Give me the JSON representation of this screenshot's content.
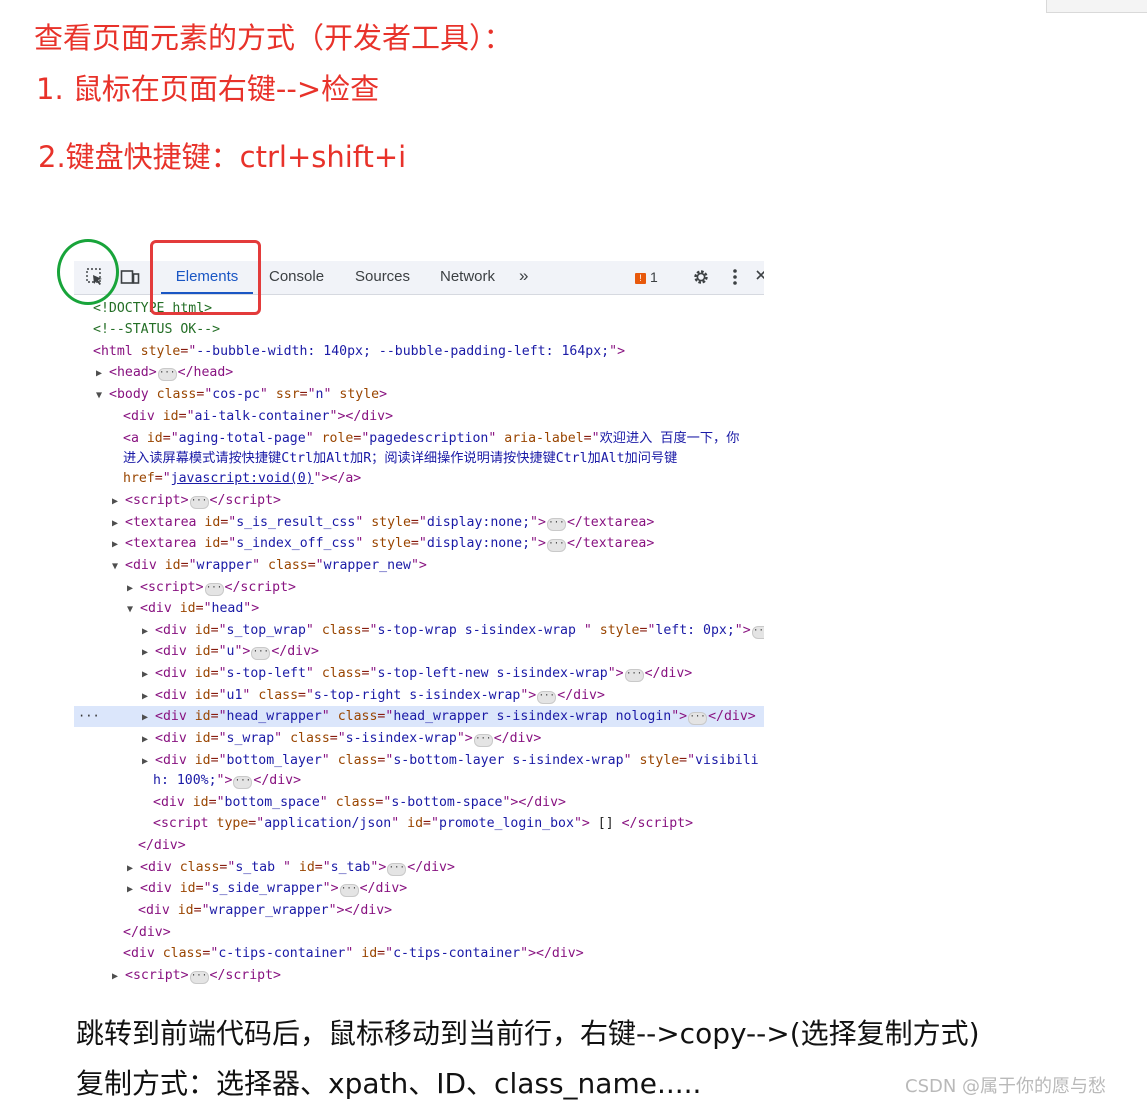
{
  "notes": {
    "line1": "查看页面元素的方式（开发者工具）：",
    "line2": "1. 鼠标在页面右键-->检查",
    "line3": "2.键盘快捷键：ctrl+shift+i",
    "line4": "跳转到前端代码后，鼠标移动到当前行，右键-->copy-->(选择复制方式)",
    "line5": "复制方式：选择器、xpath、ID、class_name....."
  },
  "devtools": {
    "tabs": [
      "Elements",
      "Console",
      "Sources",
      "Network"
    ],
    "more_tabs": "»",
    "issues_count": "1",
    "issue_badge": "!",
    "active_tab": "Elements"
  },
  "dom": {
    "doctype": "<!DOCTYPE html>",
    "comment": "<!--STATUS OK-->",
    "html_style": "--bubble-width: 140px; --bubble-padding-left: 164px;",
    "body_class": "cos-pc",
    "body_ssr": "n",
    "ai_talk_id": "ai-talk-container",
    "a_id": "aging-total-page",
    "a_role": "pagedescription",
    "a_aria_label": "欢迎进入 百度一下，你",
    "a_aria_label_cont": "进入读屏幕模式请按快捷键Ctrl加Alt加R；阅读详细操作说明请按快捷键Ctrl加Alt加问号键",
    "a_href": "javascript:void(0)",
    "ta1_id": "s_is_result_css",
    "ta2_id": "s_index_off_css",
    "ta_style": "display:none;",
    "wrapper_id": "wrapper",
    "wrapper_class": "wrapper_new",
    "head_id": "head",
    "top_wrap_id": "s_top_wrap",
    "top_wrap_class": "s-top-wrap s-isindex-wrap ",
    "top_wrap_style": "left: 0px;",
    "u_id": "u",
    "top_left_id": "s-top-left",
    "top_left_class": "s-top-left-new s-isindex-wrap",
    "u1_id": "u1",
    "u1_class": "s-top-right s-isindex-wrap",
    "head_wrapper_id": "head_wrapper",
    "head_wrapper_class": "head_wrapper s-isindex-wrap nologin",
    "s_wrap_id": "s_wrap",
    "s_wrap_class": "s-isindex-wrap",
    "bottom_layer_id": "bottom_layer",
    "bottom_layer_class": "s-bottom-layer s-isindex-wrap",
    "bottom_layer_style": "visibili",
    "bottom_layer_style_cont": "h: 100%;",
    "bottom_space_id": "bottom_space",
    "bottom_space_class": "s-bottom-space",
    "script_type": "application/json",
    "script_id": "promote_login_box",
    "script_content": " [] ",
    "s_tab_class": "s_tab ",
    "s_tab_id": "s_tab",
    "side_wrapper_id": "s_side_wrapper",
    "wrapper_wrapper_id": "wrapper_wrapper",
    "tips_class": "c-tips-container",
    "tips_id": "c-tips-container"
  },
  "watermark": "CSDN @属于你的愿与愁",
  "colors": {
    "heading_red": "#e8322a",
    "circle_green": "#18a43a",
    "box_red": "#e33b3b",
    "active_tab_blue": "#1a56c4",
    "selected_row": "#dbe6fb"
  }
}
